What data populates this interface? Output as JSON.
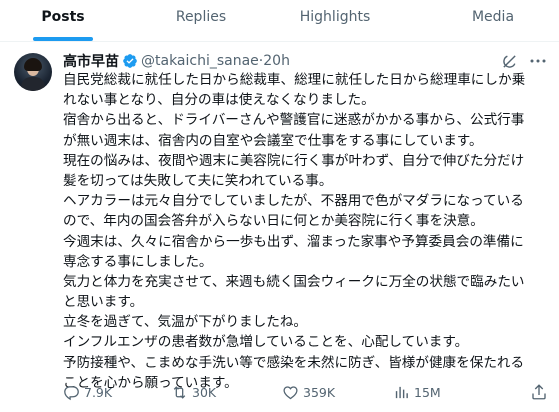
{
  "tabs": [
    "Posts",
    "Replies",
    "Highlights",
    "Media"
  ],
  "post": {
    "author_name": "高市早苗",
    "handle": "@takaichi_sanae",
    "separator": " · ",
    "time": "20h",
    "lines": [
      "自民党総裁に就任した日から総裁車、総理に就任した日から総理車にしか乗",
      "れない事となり、自分の車は使えなくなりました。",
      "宿舎から出ると、ドライバーさんや警護官に迷惑がかかる事から、公式行事",
      "が無い週末は、宿舎内の自室や会議室で仕事をする事にしています。",
      "現在の悩みは、夜間や週末に美容院に行く事が叶わず、自分で伸びた分だけ",
      "髪を切っては失敗して夫に笑われている事。",
      "ヘアカラーは元々自分でしていましたが、不器用で色がマダラになっている",
      "ので、年内の国会答弁が入らない日に何とか美容院に行く事を決意。",
      "今週末は、久々に宿舎から一歩も出ず、溜まった家事や予算委員会の準備に",
      "専念する事にしました。",
      "気力と体力を充実させて、来週も続く国会ウィークに万全の状態で臨みたい",
      "と思います。",
      "立冬を過ぎて、気温が下がりましたね。",
      "インフルエンザの患者数が急増していることを、心配しています。",
      "予防接種や、こまめな手洗い等で感染を未然に防ぎ、皆様が健康を保たれる",
      "ことを心から願っています。"
    ],
    "stats": {
      "replies": "7.9K",
      "reposts": "30K",
      "likes": "359K",
      "views": "15M"
    }
  },
  "colors": {
    "accent": "#1d9bf0",
    "text": "#0f1419",
    "muted": "#536471"
  },
  "icons": [
    "verified-badge-icon",
    "grok-icon",
    "more-icon",
    "reply-icon",
    "repost-icon",
    "like-icon",
    "views-icon",
    "share-icon"
  ]
}
